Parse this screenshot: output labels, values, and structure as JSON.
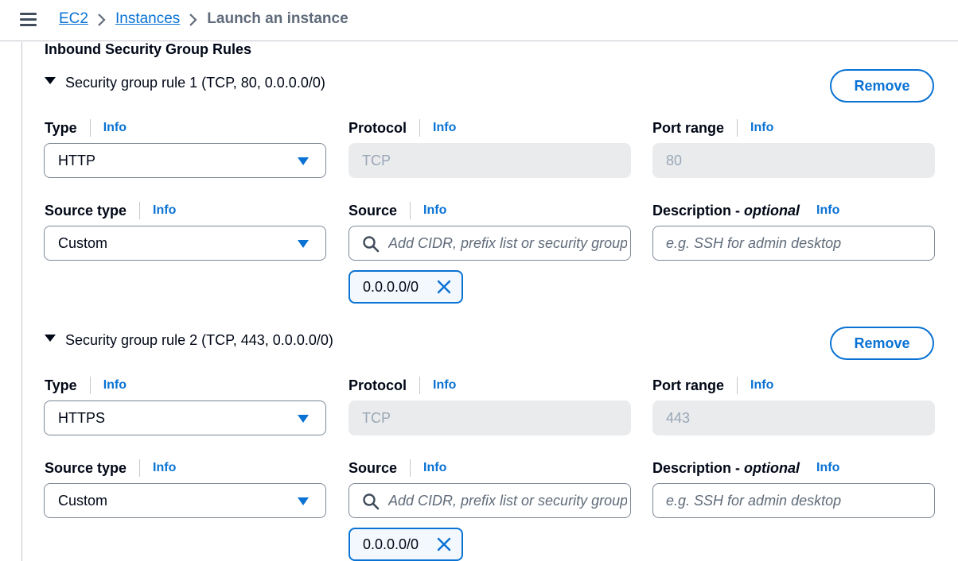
{
  "breadcrumb": {
    "items": [
      "EC2",
      "Instances"
    ],
    "current": "Launch an instance"
  },
  "section_title": "Inbound Security Group Rules",
  "rules": [
    {
      "header": "Security group rule 1 (TCP, 80, 0.0.0.0/0)",
      "remove_label": "Remove",
      "type_label": "Type",
      "type_value": "HTTP",
      "protocol_label": "Protocol",
      "protocol_value": "TCP",
      "port_label": "Port range",
      "port_value": "80",
      "source_type_label": "Source type",
      "source_type_value": "Custom",
      "source_label": "Source",
      "source_placeholder": "Add CIDR, prefix list or security group",
      "description_label": "Description - ",
      "description_optional": "optional",
      "description_placeholder": "e.g. SSH for admin desktop",
      "token": "0.0.0.0/0"
    },
    {
      "header": "Security group rule 2 (TCP, 443, 0.0.0.0/0)",
      "remove_label": "Remove",
      "type_label": "Type",
      "type_value": "HTTPS",
      "protocol_label": "Protocol",
      "protocol_value": "TCP",
      "port_label": "Port range",
      "port_value": "443",
      "source_type_label": "Source type",
      "source_type_value": "Custom",
      "source_label": "Source",
      "source_placeholder": "Add CIDR, prefix list or security group",
      "description_label": "Description - ",
      "description_optional": "optional",
      "description_placeholder": "e.g. SSH for admin desktop",
      "token": "0.0.0.0/0"
    }
  ],
  "info_label": "Info",
  "icons": {
    "menu": "hamburger-menu-icon",
    "separator": "chevron-right-icon",
    "expand": "caret-down-icon",
    "dropdown": "caret-down-icon",
    "search": "search-icon",
    "dismiss": "close-icon"
  },
  "colors": {
    "link": "#0972d3",
    "text": "#000716",
    "disabled_bg": "#e9ebed",
    "token_bg": "#f2f8fd"
  }
}
